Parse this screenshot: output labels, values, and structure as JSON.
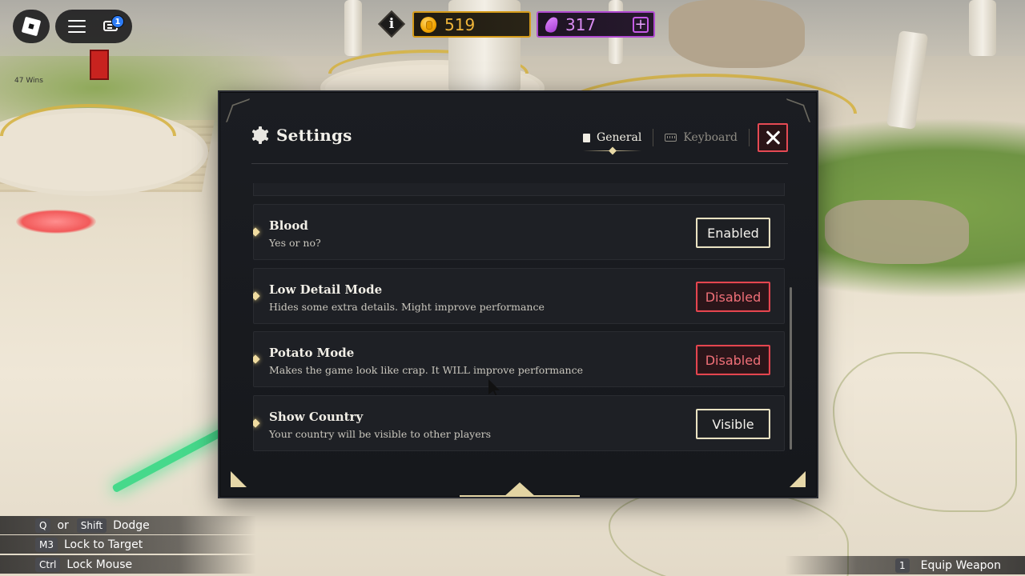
{
  "hud": {
    "wins_label": "47 Wins",
    "notification_count": "1",
    "info_label": "i",
    "coins": "519",
    "gems": "317",
    "add_label": "+"
  },
  "settings": {
    "title": "Settings",
    "tabs": [
      {
        "label": "General",
        "icon": "book-icon",
        "active": true
      },
      {
        "label": "Keyboard",
        "icon": "keyboard-icon",
        "active": false
      }
    ],
    "rows": [
      {
        "name": "Blood",
        "description": "Yes or no?",
        "state": "Enabled",
        "on": true
      },
      {
        "name": "Low Detail Mode",
        "description": "Hides some extra details. Might improve performance",
        "state": "Disabled",
        "on": false
      },
      {
        "name": "Potato Mode",
        "description": "Makes the game look like crap. It WILL improve performance",
        "state": "Disabled",
        "on": false
      },
      {
        "name": "Show Country",
        "description": "Your country will be visible to other players",
        "state": "Visible",
        "on": true
      }
    ]
  },
  "keybinds": [
    {
      "keys": [
        "Q",
        "Shift"
      ],
      "joiner": "or",
      "action": "Dodge"
    },
    {
      "keys": [
        "M3"
      ],
      "action": "Lock to Target"
    },
    {
      "keys": [
        "Ctrl"
      ],
      "action": "Lock Mouse"
    }
  ],
  "equip": {
    "key": "1",
    "action": "Equip Weapon"
  },
  "colors": {
    "enabled_border": "#e9e2c2",
    "disabled_border": "#e4454f",
    "coin_border": "#d59b1a",
    "gem_border": "#b04ad0",
    "close_red": "#e64a54"
  }
}
